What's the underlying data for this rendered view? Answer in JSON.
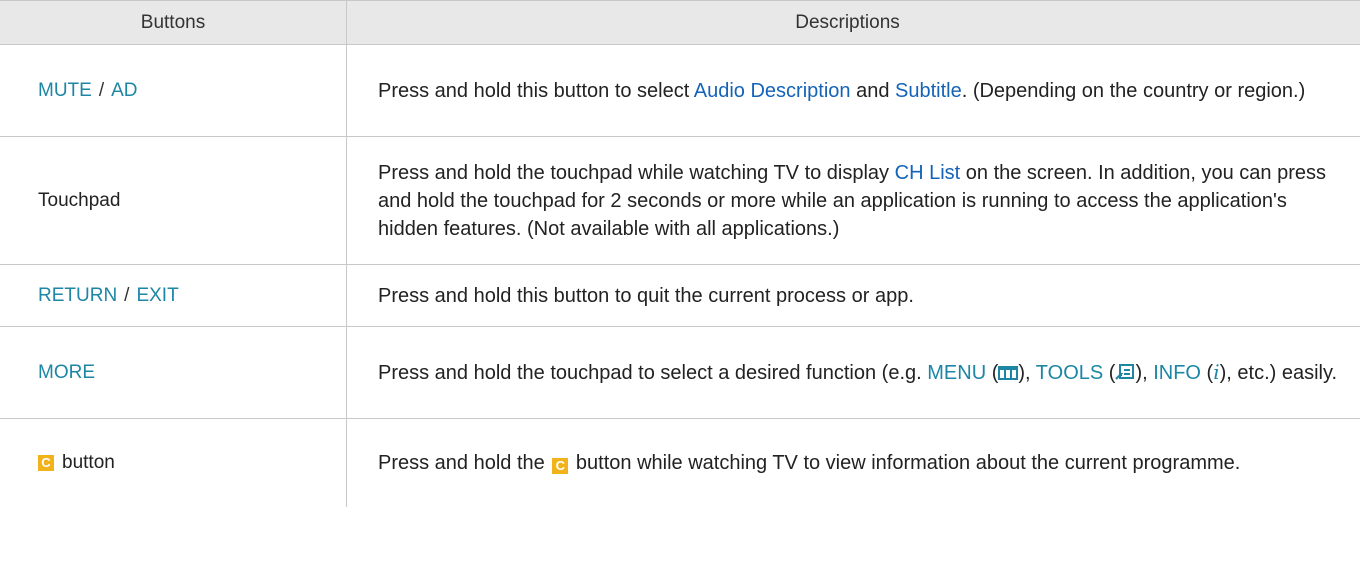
{
  "header": {
    "col1": "Buttons",
    "col2": "Descriptions"
  },
  "rows": [
    {
      "key1": "MUTE",
      "sep": "/",
      "key2": "AD",
      "d1": "Press and hold this button to select ",
      "h1": "Audio Description",
      "d2": " and ",
      "h2": "Subtitle",
      "d3": ". (Depending on the country or region.)"
    },
    {
      "plain": "Touchpad",
      "d1": "Press and hold the touchpad while watching TV to display ",
      "h1": "CH List",
      "d2": " on the screen. In addition, you can press and hold the touchpad for 2 seconds or more while an application is running to access the application's hidden features. (Not available with all applications.)"
    },
    {
      "key1": "RETURN",
      "sep": "/",
      "key2": "EXIT",
      "d1": "Press and hold this button to quit the current process or app."
    },
    {
      "key1": "MORE",
      "d1": "Press and hold the touchpad to select a desired function (e.g. ",
      "k1": "MENU",
      "p1": " (",
      "p2": "), ",
      "k2": "TOOLS",
      "p3": " (",
      "p4": "), ",
      "k3": "INFO",
      "p5": " (",
      "i": "i",
      "p6": "), etc.) easily."
    },
    {
      "badge": "C",
      "label": "button",
      "d1": "Press and hold the ",
      "d2": " button while watching TV to view information about the current programme."
    }
  ],
  "colors": {
    "key": "#1d86a5",
    "highlight": "#1463b8",
    "badge": "#f2b21a",
    "header_bg": "#e8e8e8",
    "border": "#c8c8c8"
  },
  "icons": [
    "menu-icon",
    "tools-icon",
    "c-button-icon"
  ]
}
